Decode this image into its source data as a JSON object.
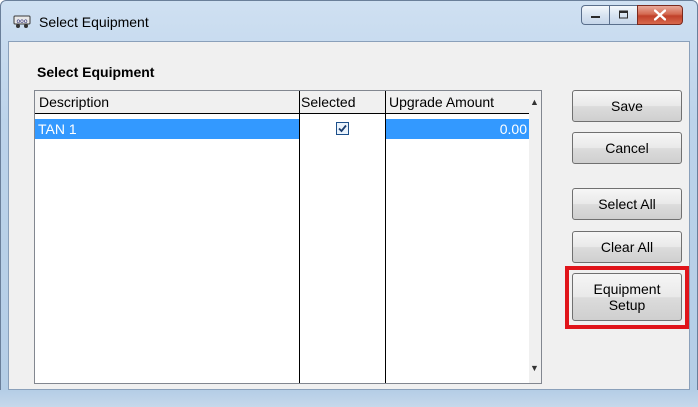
{
  "window": {
    "title": "Select Equipment",
    "icon": "equipment-app-icon"
  },
  "group": {
    "label": "Select Equipment"
  },
  "grid": {
    "columns": [
      "Description",
      "Selected",
      "Upgrade Amount"
    ],
    "rows": [
      {
        "description": "TAN 1",
        "selected": true,
        "upgrade_amount": "0.00"
      }
    ]
  },
  "buttons": {
    "save": "Save",
    "cancel": "Cancel",
    "select_all": "Select All",
    "clear_all": "Clear All",
    "equipment_setup_line1": "Equipment",
    "equipment_setup_line2": "Setup"
  },
  "colors": {
    "selection": "#3399ff",
    "highlight_box": "#e0141a"
  }
}
